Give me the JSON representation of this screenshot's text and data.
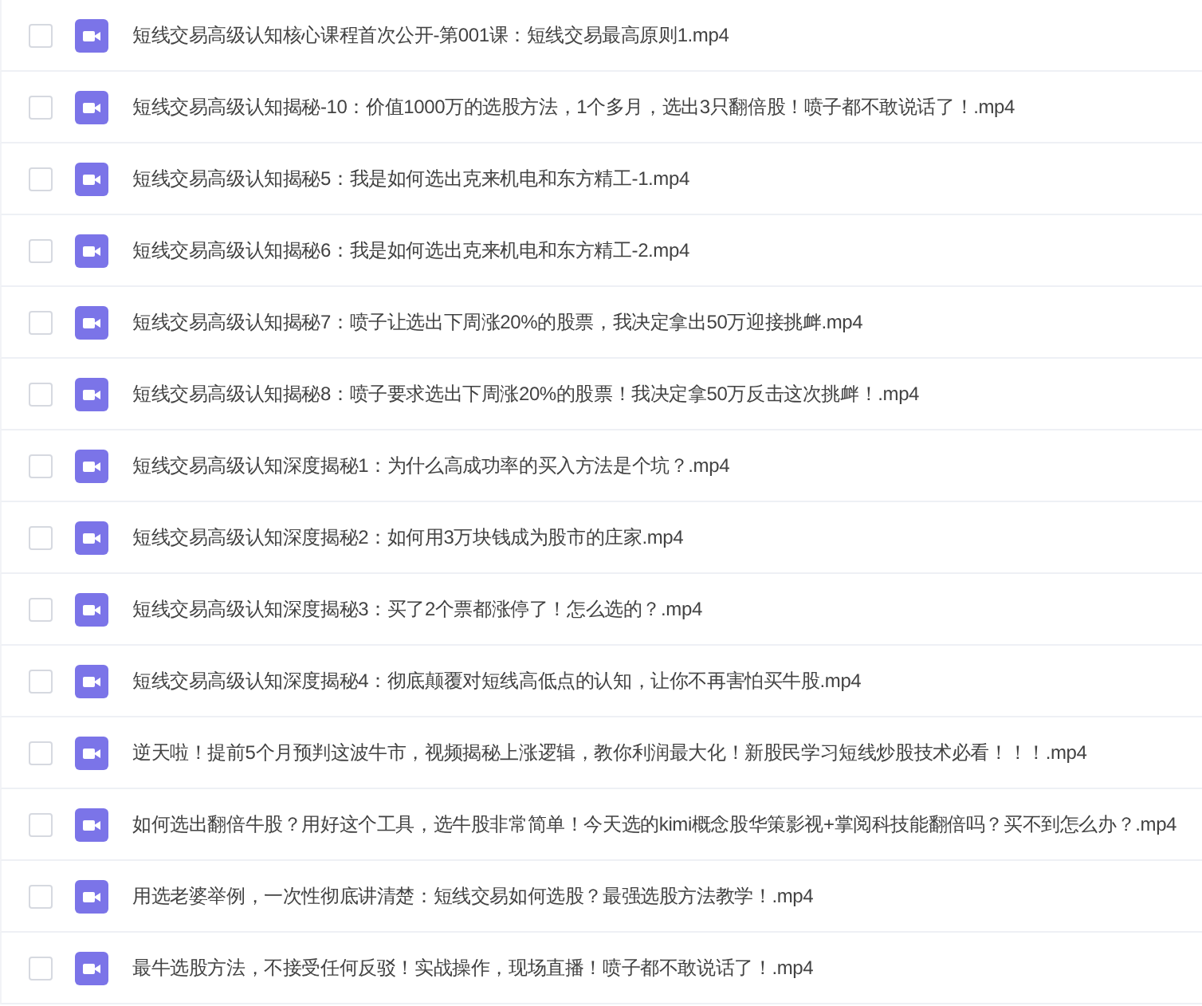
{
  "files": [
    {
      "name": "短线交易高级认知核心课程首次公开-第001课：短线交易最高原则1.mp4",
      "checked": false
    },
    {
      "name": "短线交易高级认知揭秘-10：价值1000万的选股方法，1个多月，选出3只翻倍股！喷子都不敢说话了！.mp4",
      "checked": false
    },
    {
      "name": "短线交易高级认知揭秘5：我是如何选出克来机电和东方精工-1.mp4",
      "checked": false
    },
    {
      "name": "短线交易高级认知揭秘6：我是如何选出克来机电和东方精工-2.mp4",
      "checked": false
    },
    {
      "name": "短线交易高级认知揭秘7：喷子让选出下周涨20%的股票，我决定拿出50万迎接挑衅.mp4",
      "checked": false
    },
    {
      "name": "短线交易高级认知揭秘8：喷子要求选出下周涨20%的股票！我决定拿50万反击这次挑衅！.mp4",
      "checked": false
    },
    {
      "name": "短线交易高级认知深度揭秘1：为什么高成功率的买入方法是个坑？.mp4",
      "checked": false
    },
    {
      "name": "短线交易高级认知深度揭秘2：如何用3万块钱成为股市的庄家.mp4",
      "checked": false
    },
    {
      "name": "短线交易高级认知深度揭秘3：买了2个票都涨停了！怎么选的？.mp4",
      "checked": false
    },
    {
      "name": "短线交易高级认知深度揭秘4：彻底颠覆对短线高低点的认知，让你不再害怕买牛股.mp4",
      "checked": false
    },
    {
      "name": "逆天啦！提前5个月预判这波牛市，视频揭秘上涨逻辑，教你利润最大化！新股民学习短线炒股技术必看！！！.mp4",
      "checked": false
    },
    {
      "name": "如何选出翻倍牛股？用好这个工具，选牛股非常简单！今天选的kimi概念股华策影视+掌阅科技能翻倍吗？买不到怎么办？.mp4",
      "checked": false
    },
    {
      "name": "用选老婆举例，一次性彻底讲清楚：短线交易如何选股？最强选股方法教学！.mp4",
      "checked": false
    },
    {
      "name": "最牛选股方法，不接受任何反驳！实战操作，现场直播！喷子都不敢说话了！.mp4",
      "checked": false
    }
  ]
}
